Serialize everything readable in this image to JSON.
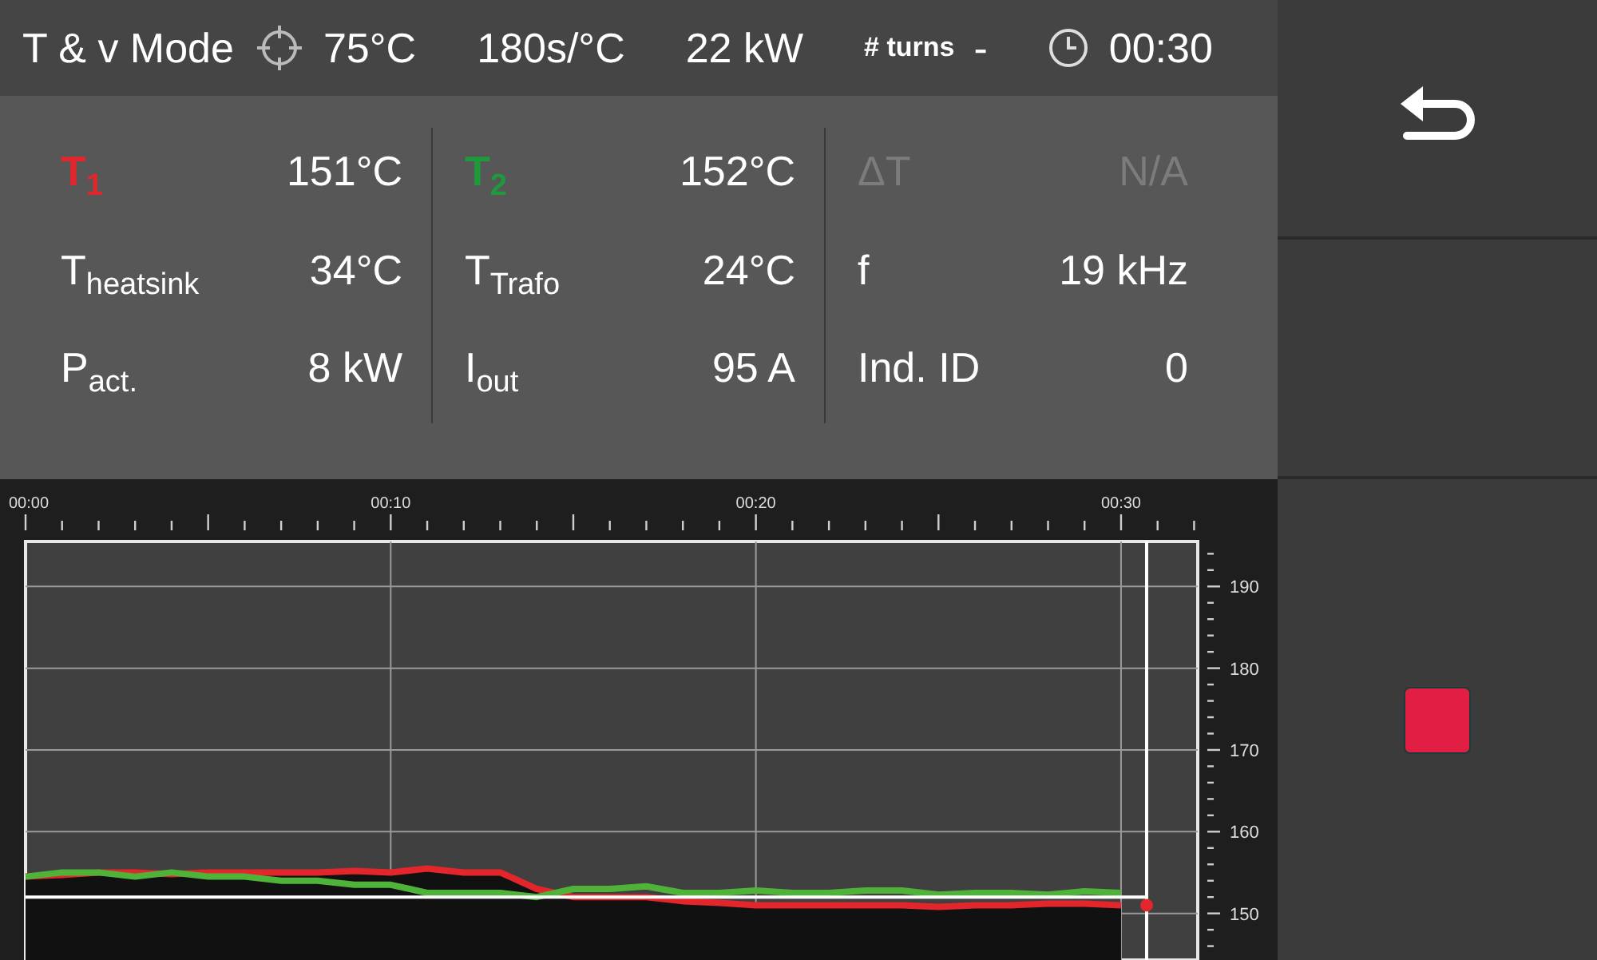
{
  "header": {
    "title": "T & v Mode",
    "items": [
      {
        "kind": "target",
        "text": "75°C"
      },
      {
        "kind": "plain",
        "text": "180s/°C"
      },
      {
        "kind": "plain",
        "text": "22 kW"
      },
      {
        "kind": "label",
        "text": "# turns"
      },
      {
        "kind": "plain",
        "text": "-"
      },
      {
        "kind": "clock",
        "text": "00:30"
      }
    ]
  },
  "readings": [
    [
      {
        "label": "T$_{1}$",
        "value": "151°C",
        "color": "#e3262b",
        "disabled": false
      },
      {
        "label": "T$_{heatsink}$",
        "value": "34°C",
        "disabled": false
      },
      {
        "label": "P$_{act.}$",
        "value": "8 kW",
        "disabled": false
      }
    ],
    [
      {
        "label": "T$_{2}$",
        "value": "152°C",
        "color": "#1e9a3c",
        "disabled": false
      },
      {
        "label": "T$_{Trafo}$",
        "value": "24°C",
        "disabled": false
      },
      {
        "label": "I$_{out}$",
        "value": "95 A",
        "disabled": false
      }
    ],
    [
      {
        "label": "ΔT",
        "value": "N/A",
        "disabled": true
      },
      {
        "label": "f",
        "value": "19 kHz",
        "disabled": false
      },
      {
        "label": "Ind. ID",
        "value": "0",
        "disabled": false
      }
    ]
  ],
  "chart": {
    "chart_data": {
      "type": "line",
      "xlim": [
        0,
        32.1
      ],
      "ylim": [
        144.3,
        195.5
      ],
      "grid": true,
      "ref_lines": [
        {
          "axis": "y",
          "value": 152
        },
        {
          "axis": "x",
          "value": 30.7
        }
      ],
      "x": [
        0,
        1,
        2,
        3,
        4,
        5,
        6,
        7,
        8,
        9,
        10,
        11,
        12,
        13,
        14,
        15,
        16,
        17,
        18,
        19,
        20,
        21,
        22,
        23,
        24,
        25,
        26,
        27,
        28,
        29,
        30
      ],
      "xticks": [
        {
          "value": 0,
          "label": "00:00"
        },
        {
          "value": 10,
          "label": "00:10"
        },
        {
          "value": 20,
          "label": "00:20"
        },
        {
          "value": 30,
          "label": "00:30"
        }
      ],
      "yticks": [
        150,
        160,
        170,
        180,
        190
      ],
      "series": [
        {
          "color": "#e3262b",
          "values": [
            154.5,
            154.7,
            155,
            155,
            154.8,
            155,
            155,
            155,
            155,
            155.2,
            155,
            155.5,
            155,
            155,
            153,
            152,
            152,
            152,
            151.5,
            151.3,
            151,
            151,
            151,
            151,
            151,
            150.8,
            151,
            151,
            151.2,
            151.2,
            151
          ]
        },
        {
          "color": "#4fb33a",
          "values": [
            154.5,
            155,
            155,
            154.5,
            155,
            154.5,
            154.5,
            154,
            154,
            153.5,
            153.5,
            152.5,
            152.5,
            152.5,
            152,
            153,
            153,
            153.3,
            152.5,
            152.5,
            152.8,
            152.5,
            152.5,
            152.8,
            152.8,
            152.3,
            152.5,
            152.5,
            152.3,
            152.7,
            152.5
          ]
        }
      ]
    }
  },
  "buttons": [
    {
      "kind": "back"
    },
    {
      "kind": "blank"
    },
    {
      "kind": "stop"
    }
  ]
}
